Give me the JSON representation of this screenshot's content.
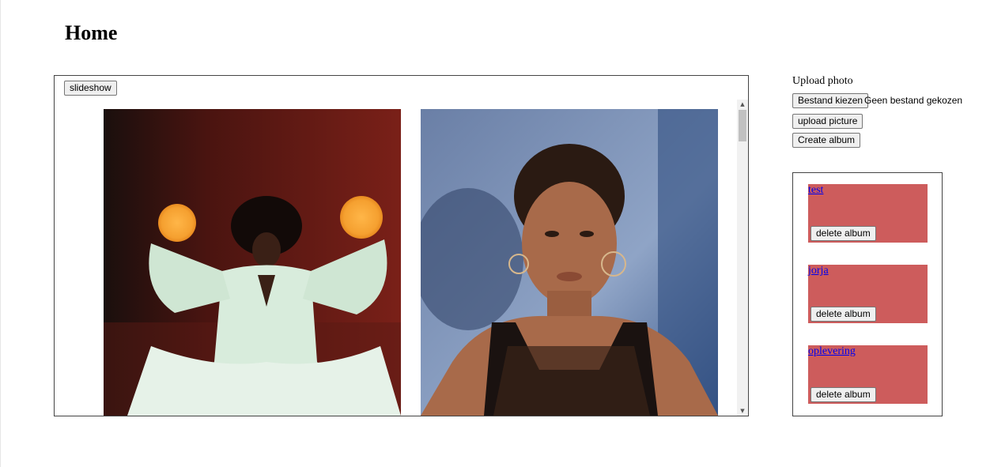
{
  "page": {
    "title": "Home"
  },
  "gallery": {
    "slideshow_label": "slideshow",
    "photos": [
      {
        "description": "woman-in-white-with-orange-orbs"
      },
      {
        "description": "woman-with-braids-and-hoop-earrings"
      }
    ]
  },
  "upload": {
    "label": "Upload photo",
    "choose_file_label": "Bestand kiezen",
    "file_status": "Geen bestand gekozen",
    "upload_button_label": "upload picture",
    "create_album_label": "Create album"
  },
  "albums": [
    {
      "name": "test",
      "delete_label": "delete album"
    },
    {
      "name": "jorja",
      "delete_label": "delete album"
    },
    {
      "name": "oplevering",
      "delete_label": "delete album"
    }
  ],
  "colors": {
    "album_bg": "#cd5c5c",
    "link": "#0000ee"
  }
}
